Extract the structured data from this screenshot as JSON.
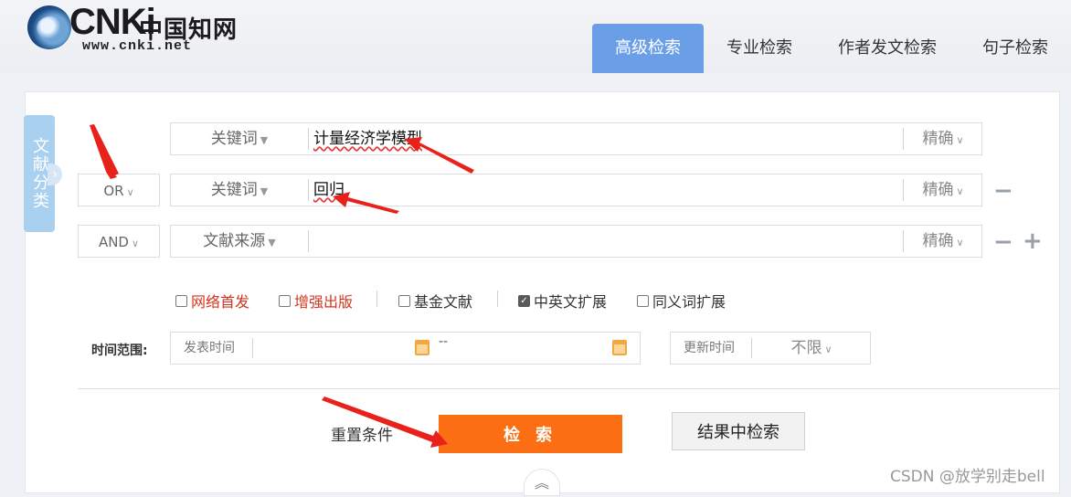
{
  "logo": {
    "brand": "CNKi",
    "chinese": "中国知网",
    "url": "www.cnki.net"
  },
  "tabs": [
    {
      "label": "高级检索",
      "active": true
    },
    {
      "label": "专业检索",
      "active": false
    },
    {
      "label": "作者发文检索",
      "active": false
    },
    {
      "label": "句子检索",
      "active": false
    }
  ],
  "side_tab": {
    "label": "文献分类"
  },
  "rows": [
    {
      "logic": "",
      "field": "关键词",
      "value": "计量经济学模型",
      "match": "精确"
    },
    {
      "logic": "OR",
      "field": "关键词",
      "value": "回归",
      "match": "精确"
    },
    {
      "logic": "AND",
      "field": "文献来源",
      "value": "",
      "match": "精确"
    }
  ],
  "row_controls": {
    "minus": "−",
    "plus": "+"
  },
  "options": [
    {
      "label": "网络首发",
      "checked": false,
      "color": "#d2351f"
    },
    {
      "label": "增强出版",
      "checked": false,
      "color": "#d2351f"
    },
    {
      "label": "基金文献",
      "checked": false,
      "color": "#333333"
    },
    {
      "label": "中英文扩展",
      "checked": true,
      "color": "#333333"
    },
    {
      "label": "同义词扩展",
      "checked": false,
      "color": "#333333"
    }
  ],
  "time": {
    "label": "时间范围:",
    "publish_label": "发表时间",
    "dash": "--",
    "update_label": "更新时间",
    "update_value": "不限"
  },
  "actions": {
    "reset": "重置条件",
    "search": "检 索",
    "refine": "结果中检索"
  },
  "watermark": "CSDN @放学别走bell",
  "colors": {
    "tab_active": "#6a9fe8",
    "search_button": "#fb6e14",
    "annotation_arrow": "#e8221b"
  }
}
